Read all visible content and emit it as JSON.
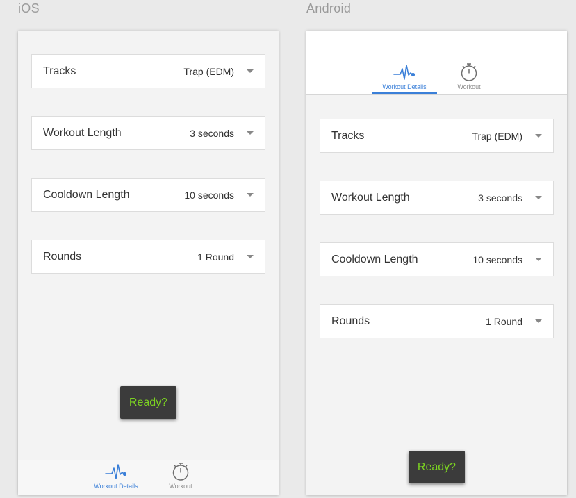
{
  "labels": {
    "ios": "iOS",
    "android": "Android"
  },
  "fields": [
    {
      "label": "Tracks",
      "value": "Trap (EDM)"
    },
    {
      "label": "Workout Length",
      "value": "3 seconds"
    },
    {
      "label": "Cooldown Length",
      "value": "10 seconds"
    },
    {
      "label": "Rounds",
      "value": "1 Round"
    }
  ],
  "ready_button": "Ready?",
  "tabs": [
    {
      "label": "Workout Details",
      "icon": "heartbeat-icon",
      "active": true
    },
    {
      "label": "Workout",
      "icon": "stopwatch-icon",
      "active": false
    }
  ],
  "colors": {
    "accent": "#3a7fd8",
    "ready_text": "#7cd321",
    "ready_bg": "#3b3b3b",
    "screen_bg": "#f3f3f3"
  }
}
